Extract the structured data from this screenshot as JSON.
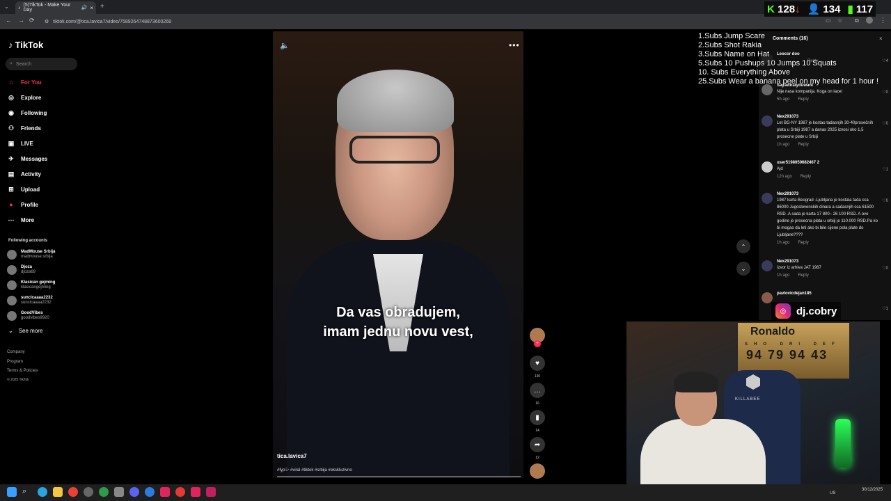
{
  "browser": {
    "tab_title": "(5)TikTok - Make Your Day",
    "new_tab": "+",
    "url": "tiktok.com/@tica.lavica7/video/7589264748873600268"
  },
  "stats": {
    "k_count": "128",
    "g_count": "134",
    "bars_count": "117"
  },
  "sidebar": {
    "logo": "TikTok",
    "search_placeholder": "Search",
    "nav": [
      {
        "label": "For You",
        "icon": "home-icon",
        "color": "#fe2c55"
      },
      {
        "label": "Explore",
        "icon": "compass-icon"
      },
      {
        "label": "Following",
        "icon": "following-icon"
      },
      {
        "label": "Friends",
        "icon": "friends-icon"
      },
      {
        "label": "LIVE",
        "icon": "live-icon"
      },
      {
        "label": "Messages",
        "icon": "messages-icon"
      },
      {
        "label": "Activity",
        "icon": "activity-icon"
      },
      {
        "label": "Upload",
        "icon": "upload-icon"
      },
      {
        "label": "Profile",
        "icon": "profile-icon"
      },
      {
        "label": "More",
        "icon": "more-icon"
      }
    ],
    "following_title": "Following accounts",
    "accounts": [
      {
        "name": "MadMouse Srbija",
        "handle": "madmouse.srbija"
      },
      {
        "name": "Djoza",
        "handle": "djoza69"
      },
      {
        "name": "Klasican gejming",
        "handle": "klasicangejming"
      },
      {
        "name": "suncicaaaa2232",
        "handle": "suncicaaaa2232"
      },
      {
        "name": "GoodVibes",
        "handle": "goodvibes9920"
      }
    ],
    "see_more": "See more",
    "footer": [
      "Company",
      "Program",
      "Terms & Policies",
      "© 2025 TikTok"
    ]
  },
  "video": {
    "caption_line1": "Da vas obradujem,",
    "caption_line2": "imam jednu novu vest,",
    "username": "tica.lavica7",
    "tags": "#fypシ #viral #tiktok #srbija #ekskluzivno",
    "likes": "130",
    "comments": "16",
    "saves": "14",
    "shares": "12"
  },
  "overlay_goals": [
    "1.Subs Jump Scare",
    "2.Subs Shot Rakia",
    "3.Subs Name on Hat",
    "5.Subs 10 Pushups 10 Jumps 10 Squats",
    "10. Subs Everything Above",
    "25.Subs Wear a banana peel on my head for 1 hour !"
  ],
  "comments_panel": {
    "title": "Comments (16)",
    "items": [
      {
        "user": "Leocor doo",
        "text": "",
        "time": "",
        "likes": "4"
      },
      {
        "user": "Sayawhatyouwant",
        "text": "Nije nasa kompanija. Koga on laze/",
        "time": "5h ago",
        "likes": "0"
      },
      {
        "user": "Nex291073",
        "text": "Let BG-NY 1987 je kostao tadasnjih 30-40prosečnih plata u Srbiji 1987 a danas 2025 iznosi oko 1,5 prosecne plate u Srbiji",
        "time": "1h ago",
        "likes": "0"
      },
      {
        "user": "user5198050682467 2",
        "text": "Ajd",
        "time": "12h ago",
        "likes": "1"
      },
      {
        "user": "Nex291073",
        "text": "1987 karta Beograd -Ljubljana je kostala tada cca 86000 Jugoslovenskih dinara a sadasnjih cca 61500 RSD .A sada je karta 17 800– 26 100 RSD. A ove godine je prosecna plata u srbiji je 110.000 RSD.Pa ko bi mogao da leti ako bi bile cijene pola plate do Ljubljane????",
        "time": "1h ago",
        "likes": "0"
      },
      {
        "user": "Nex291073",
        "text": "Izvor iz arhiva JAT 1987",
        "time": "1h ago",
        "likes": "0"
      },
      {
        "user": "pavlovicdejan185",
        "text": "",
        "time": "",
        "likes": "1"
      }
    ],
    "reply_label": "Reply"
  },
  "streamer": {
    "ig_handle": "dj.cobry",
    "poster_name": "Ronaldo",
    "poster_stats_labels": "SHO DRI DEF",
    "poster_stats_values": "94 79 94 43",
    "chair_brand": "KILLABEE"
  },
  "taskbar": {
    "lang": "US",
    "time": "",
    "date": "30/12/2025"
  }
}
